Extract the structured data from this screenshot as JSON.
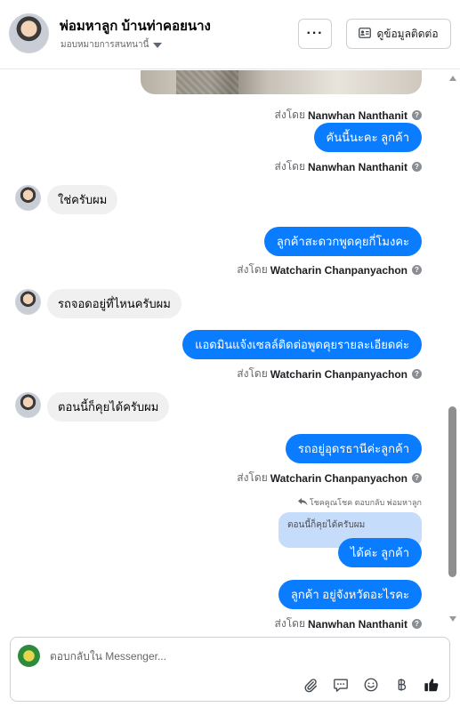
{
  "header": {
    "page_name": "พ่อมหาลูก บ้านท่าคอยนาง",
    "assign_label": "มอบหมายการสนทนานี้",
    "more_label": "···",
    "contact_button": "ดูข้อมูลติดต่อ"
  },
  "messages": [
    {
      "side": "out",
      "text": "คันนี้นะคะ  ลูกค้า"
    },
    {
      "sent_by_prefix": "ส่งโดย",
      "sender": "Nanwhan Nanthanit"
    },
    {
      "side": "in",
      "text": "ใช่ครับผม"
    },
    {
      "side": "out",
      "text": "ลูกค้าสะดวกพูดคุยกี่โมงคะ"
    },
    {
      "side": "in",
      "text": "รถจอดอยู่ที่ไหนครับผม"
    },
    {
      "side": "out",
      "text": "แอดมินแจ้งเซลล์ติดต่อพูดคุยรายละเอียดค่ะ"
    },
    {
      "side": "in",
      "text": "ตอนนี้ก็คุยได้ครับผม"
    },
    {
      "side": "out",
      "text": "รถอยู่อุดรธานีค่ะลูกค้า"
    },
    {
      "side": "out",
      "text": "ได้ค่ะ  ลูกค้า"
    },
    {
      "side": "out",
      "text": "ลูกค้า อยู่จังหวัดอะไรคะ"
    }
  ],
  "sent_by": {
    "prefix": "ส่งโดย",
    "nanwhan": "Nanwhan Nanthanit",
    "watcharin": "Watcharin Chanpanyachon",
    "help_glyph": "?"
  },
  "reply": {
    "note": "โชคคูณโชค ตอบกลับ พ่อมหาลูก",
    "quoted_text": "ตอนนี้ก็คุยได้ครับผม"
  },
  "composer": {
    "placeholder": "ตอบกลับใน Messenger..."
  },
  "icons": [
    "attach-icon",
    "saved-reply-icon",
    "emoji-icon",
    "baht-icon",
    "like-icon",
    "contact-card-icon",
    "caret-down-icon",
    "help-icon",
    "reply-arrow-icon"
  ],
  "colors": {
    "outgoing_bubble": "#0a7cff",
    "incoming_bubble": "#f0f0f0",
    "quoted_bubble": "#c5dcfa"
  }
}
